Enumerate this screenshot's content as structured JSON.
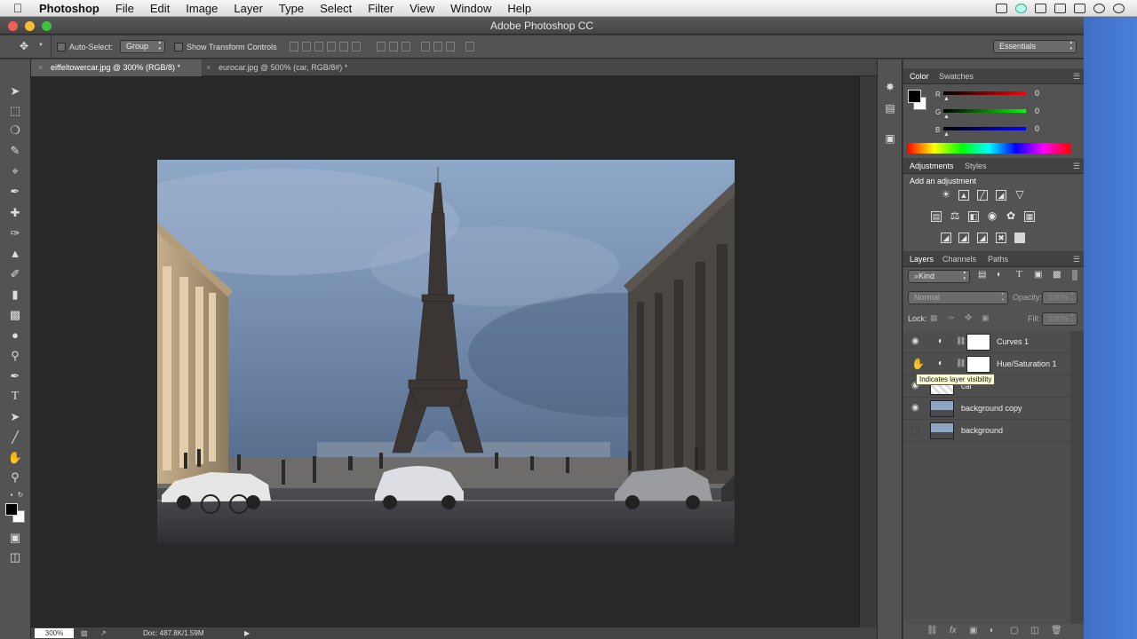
{
  "menubar": {
    "app": "Photoshop",
    "items": [
      "File",
      "Edit",
      "Image",
      "Layer",
      "Type",
      "Select",
      "Filter",
      "View",
      "Window",
      "Help"
    ]
  },
  "window": {
    "title": "Adobe Photoshop CC"
  },
  "options": {
    "auto_select_label": "Auto-Select:",
    "auto_select_value": "Group",
    "show_transform_label": "Show Transform Controls",
    "workspace": "Essentials"
  },
  "tabs": [
    {
      "label": "eiffeltowercar.jpg @ 300% (RGB/8) *",
      "active": true
    },
    {
      "label": "eurocar.jpg @ 500% (car, RGB/8#) *",
      "active": false
    }
  ],
  "status": {
    "zoom": "300%",
    "doc": "Doc: 487.8K/1.59M"
  },
  "color_panel": {
    "tabs": [
      "Color",
      "Swatches"
    ],
    "r_label": "R",
    "r_value": "0",
    "g_label": "G",
    "g_value": "0",
    "b_label": "B",
    "b_value": "0"
  },
  "adjustments_panel": {
    "tabs": [
      "Adjustments",
      "Styles"
    ],
    "heading": "Add an adjustment"
  },
  "layers_panel": {
    "tabs": [
      "Layers",
      "Channels",
      "Paths"
    ],
    "filter_kind": "Kind",
    "blend_mode": "Normal",
    "opacity_label": "Opacity:",
    "opacity_value": "100%",
    "lock_label": "Lock:",
    "fill_label": "Fill:",
    "fill_value": "100%",
    "tooltip": "Indicates layer visibility",
    "layers": [
      {
        "name": "Curves 1",
        "type": "adjustment"
      },
      {
        "name": "Hue/Saturation 1",
        "type": "adjustment"
      },
      {
        "name": "car",
        "type": "pixel"
      },
      {
        "name": "background copy",
        "type": "pixel"
      },
      {
        "name": "background",
        "type": "pixel"
      }
    ]
  },
  "colors": {
    "accent_fg": "#000000",
    "accent_bg": "#ffffff"
  }
}
